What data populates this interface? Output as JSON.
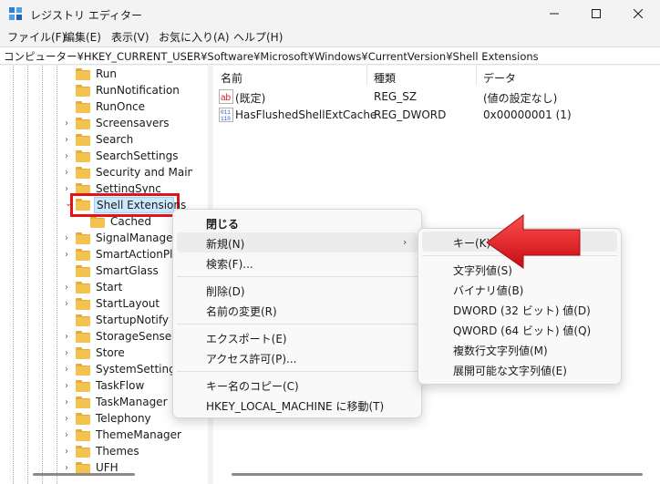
{
  "window": {
    "title": "レジストリ エディター"
  },
  "menubar": {
    "items": [
      "ファイル(F)",
      "編集(E)",
      "表示(V)",
      "お気に入り(A)",
      "ヘルプ(H)"
    ]
  },
  "address": {
    "path": "コンピューター¥HKEY_CURRENT_USER¥Software¥Microsoft¥Windows¥CurrentVersion¥Shell Extensions"
  },
  "tree": {
    "items": [
      {
        "label": "Run",
        "expandable": false
      },
      {
        "label": "RunNotification",
        "expandable": false
      },
      {
        "label": "RunOnce",
        "expandable": false
      },
      {
        "label": "Screensavers",
        "expandable": true
      },
      {
        "label": "Search",
        "expandable": true
      },
      {
        "label": "SearchSettings",
        "expandable": true
      },
      {
        "label": "Security and Mainte",
        "expandable": true
      },
      {
        "label": "SettingSync",
        "expandable": true
      },
      {
        "label": "Shell Extensions",
        "expandable": true,
        "selected": true
      },
      {
        "label": "Cached",
        "expandable": false,
        "child": true
      },
      {
        "label": "SignalManager",
        "expandable": true
      },
      {
        "label": "SmartActionPlat",
        "expandable": true
      },
      {
        "label": "SmartGlass",
        "expandable": false
      },
      {
        "label": "Start",
        "expandable": true
      },
      {
        "label": "StartLayout",
        "expandable": true
      },
      {
        "label": "StartupNotify",
        "expandable": false
      },
      {
        "label": "StorageSense",
        "expandable": true
      },
      {
        "label": "Store",
        "expandable": true
      },
      {
        "label": "SystemSettings",
        "expandable": true
      },
      {
        "label": "TaskFlow",
        "expandable": true
      },
      {
        "label": "TaskManager",
        "expandable": true
      },
      {
        "label": "Telephony",
        "expandable": true
      },
      {
        "label": "ThemeManager",
        "expandable": true
      },
      {
        "label": "Themes",
        "expandable": true
      },
      {
        "label": "UFH",
        "expandable": true
      }
    ]
  },
  "list": {
    "columns": [
      "名前",
      "種類",
      "データ"
    ],
    "rows": [
      {
        "name": "(既定)",
        "type": "REG_SZ",
        "data": "(値の設定なし)",
        "icon": "string-value-icon"
      },
      {
        "name": "HasFlushedShellExtCache",
        "type": "REG_DWORD",
        "data": "0x00000001 (1)",
        "icon": "binary-value-icon"
      }
    ]
  },
  "context_menu": {
    "items": [
      "閉じる",
      "新規(N)",
      "検索(F)...",
      "削除(D)",
      "名前の変更(R)",
      "エクスポート(E)",
      "アクセス許可(P)...",
      "キー名のコピー(C)",
      "HKEY_LOCAL_MACHINE に移動(T)"
    ]
  },
  "submenu": {
    "items": [
      "キー(K)",
      "文字列値(S)",
      "バイナリ値(B)",
      "DWORD (32 ビット) 値(D)",
      "QWORD (64 ビット) 値(Q)",
      "複数行文字列値(M)",
      "展開可能な文字列値(E)"
    ]
  },
  "colors": {
    "highlight_border": "#e3131a",
    "arrow": "#e3131a",
    "selection": "#cce8ff",
    "folder": "#f4c34e"
  }
}
